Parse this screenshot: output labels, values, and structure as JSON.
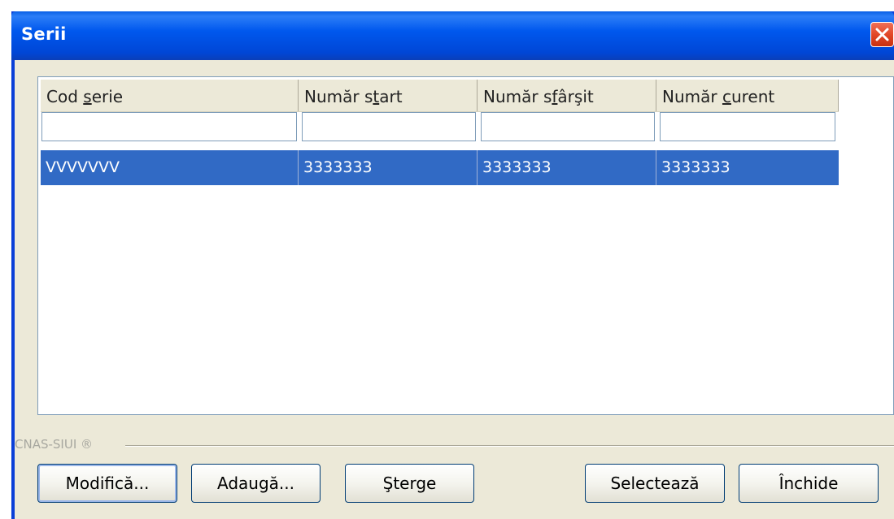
{
  "window": {
    "title": "Serii",
    "close_icon": "close-icon"
  },
  "grid": {
    "columns": [
      {
        "label": "Cod serie",
        "accesskey_index": 4
      },
      {
        "label": "Număr start",
        "accesskey_index": 7
      },
      {
        "label": "Număr sfârşit",
        "accesskey_index": 7
      },
      {
        "label": "Număr curent",
        "accesskey_index": 6
      }
    ],
    "filters": [
      "",
      "",
      "",
      ""
    ],
    "rows": [
      [
        "VVVVVVV",
        "3333333",
        "3333333",
        "3333333"
      ]
    ],
    "selected_row_color": "#316ac5"
  },
  "footer": {
    "group_label": "CNAS-SIUI ®"
  },
  "buttons": {
    "modify": "Modifică...",
    "add": "Adaugă...",
    "delete": "Şterge",
    "select": "Selectează",
    "close": "Închide"
  }
}
